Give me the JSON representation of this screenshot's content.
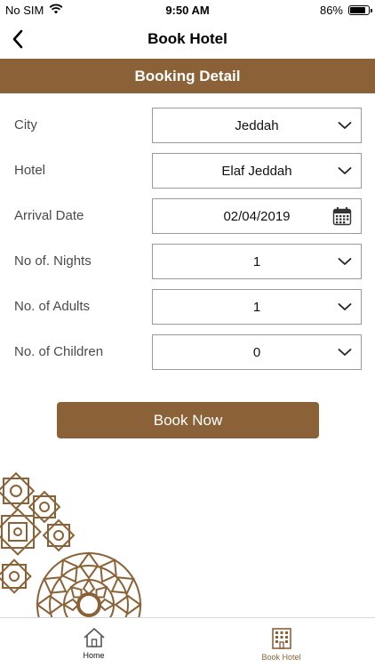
{
  "status": {
    "carrier": "No SIM",
    "time": "9:50 AM",
    "battery": "86%",
    "battery_level": 0.86
  },
  "nav": {
    "title": "Book Hotel",
    "back_icon": "chevron-left-icon"
  },
  "section": {
    "title": "Booking Detail"
  },
  "form": {
    "city": {
      "label": "City",
      "value": "Jeddah"
    },
    "hotel": {
      "label": "Hotel",
      "value": "Elaf Jeddah"
    },
    "arrival": {
      "label": "Arrival Date",
      "value": "02/04/2019"
    },
    "nights": {
      "label": "No of. Nights",
      "value": "1"
    },
    "adults": {
      "label": "No. of Adults",
      "value": "1"
    },
    "children": {
      "label": "No. of Children",
      "value": "0"
    }
  },
  "actions": {
    "book_now": "Book Now"
  },
  "tabs": {
    "home": "Home",
    "book_hotel": "Book Hotel"
  },
  "colors": {
    "brand": "#8b6237",
    "border": "#9a9a9a"
  }
}
